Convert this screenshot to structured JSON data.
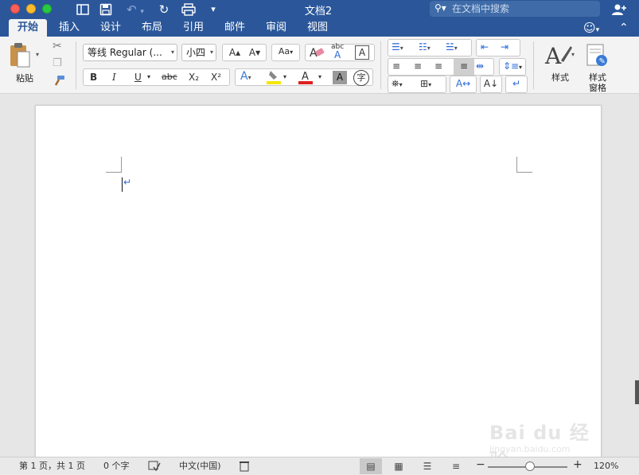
{
  "titlebar": {
    "title": "文档2",
    "search_placeholder": "在文档中搜索",
    "icons": [
      "sidebar-icon",
      "save-icon",
      "undo-icon",
      "redo-icon",
      "print-icon",
      "customize-icon",
      "share-icon"
    ]
  },
  "tabs": [
    {
      "label": "开始",
      "active": true
    },
    {
      "label": "插入"
    },
    {
      "label": "设计"
    },
    {
      "label": "布局"
    },
    {
      "label": "引用"
    },
    {
      "label": "邮件"
    },
    {
      "label": "审阅"
    },
    {
      "label": "视图"
    }
  ],
  "ribbon": {
    "paste_label": "粘贴",
    "font_name": "等线 Regular (...",
    "font_size": "小四",
    "bold": "B",
    "italic": "I",
    "underline": "U",
    "strikethrough": "abc",
    "subscript": "X₂",
    "superscript": "X²",
    "grow_font": "A▴",
    "shrink_font": "A▾",
    "change_case": "Aa",
    "styles_label": "样式",
    "styles_pane_label": "样式\n窗格",
    "styles_pane_line1": "样式",
    "styles_pane_line2": "窗格",
    "highlight_color": "#f5e600",
    "font_color": "#e02020"
  },
  "document": {
    "paragraph_mark": "↵"
  },
  "statusbar": {
    "page_info": "第 1 页，共 1 页",
    "word_count": "0 个字",
    "language": "中文(中国)",
    "zoom": "120%",
    "zoom_minus": "−",
    "zoom_plus": "+"
  },
  "watermark": {
    "text": "Bai du 经验",
    "sub": "jingyan.baidu.com"
  }
}
